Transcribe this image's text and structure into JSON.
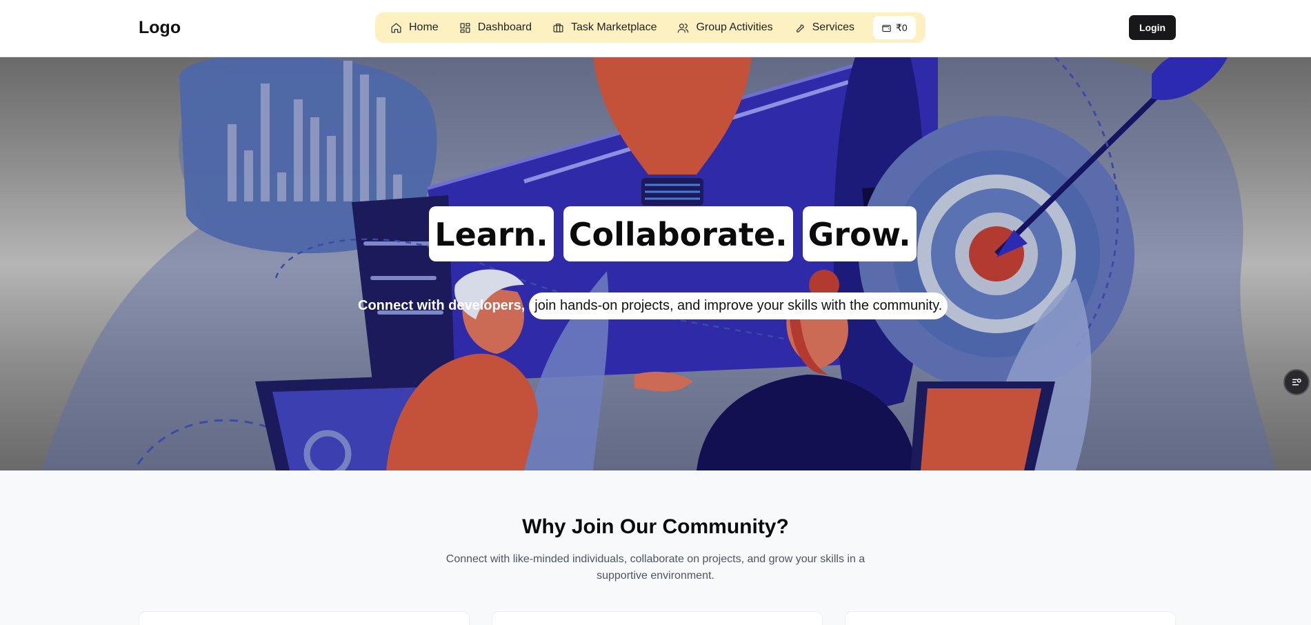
{
  "header": {
    "logo": "Logo",
    "nav": [
      {
        "label": "Home",
        "icon": "home-icon"
      },
      {
        "label": "Dashboard",
        "icon": "dashboard-icon"
      },
      {
        "label": "Task Marketplace",
        "icon": "briefcase-icon"
      },
      {
        "label": "Group Activities",
        "icon": "users-icon"
      },
      {
        "label": "Services",
        "icon": "wrench-icon"
      }
    ],
    "wallet_balance": "₹0",
    "login_label": "Login"
  },
  "hero": {
    "words": [
      "Learn.",
      "Collaborate.",
      "Grow."
    ],
    "subtitle_plain": "Connect with developers,",
    "subtitle_pill": "join hands-on projects, and improve your skills with the community."
  },
  "why": {
    "title": "Why Join Our Community?",
    "subtitle": "Connect with like-minded individuals, collaborate on projects, and grow your skills in a supportive environment."
  },
  "colors": {
    "nav_bg": "#fdf1c2",
    "login_bg": "#18181b",
    "hero_blue": "#2e2aa8",
    "hero_orange": "#c4523a"
  }
}
